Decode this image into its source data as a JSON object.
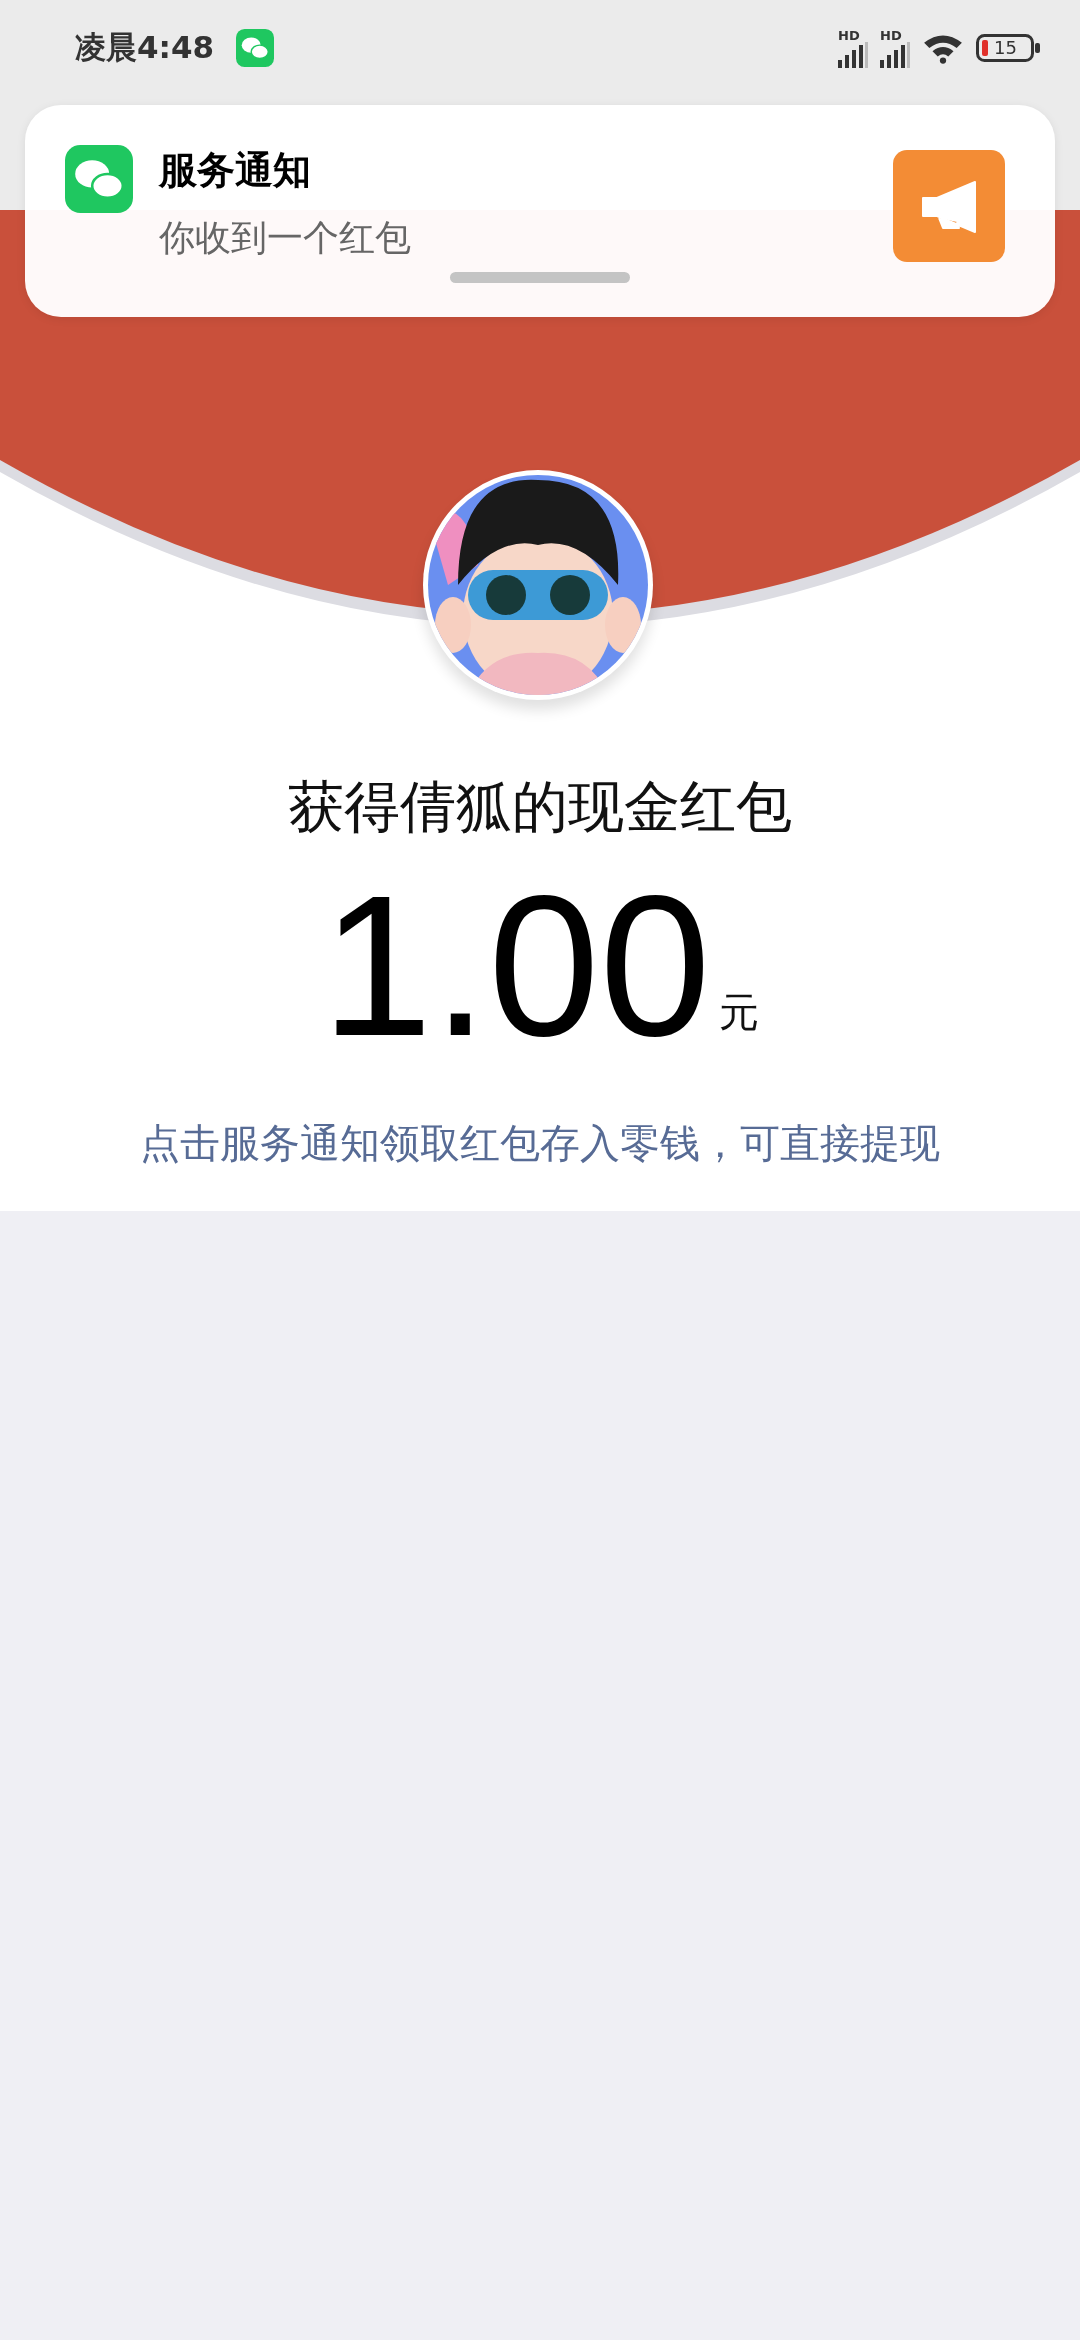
{
  "status_bar": {
    "time": "凌晨4:48",
    "signals": [
      {
        "label": "HD"
      },
      {
        "label": "HD"
      }
    ],
    "battery": "15"
  },
  "notification": {
    "title": "服务通知",
    "message": "你收到一个红包"
  },
  "red_packet": {
    "title": "获得倩狐的现金红包",
    "amount": "1.00",
    "unit": "元",
    "hint": "点击服务通知领取红包存入零钱，可直接提现"
  }
}
